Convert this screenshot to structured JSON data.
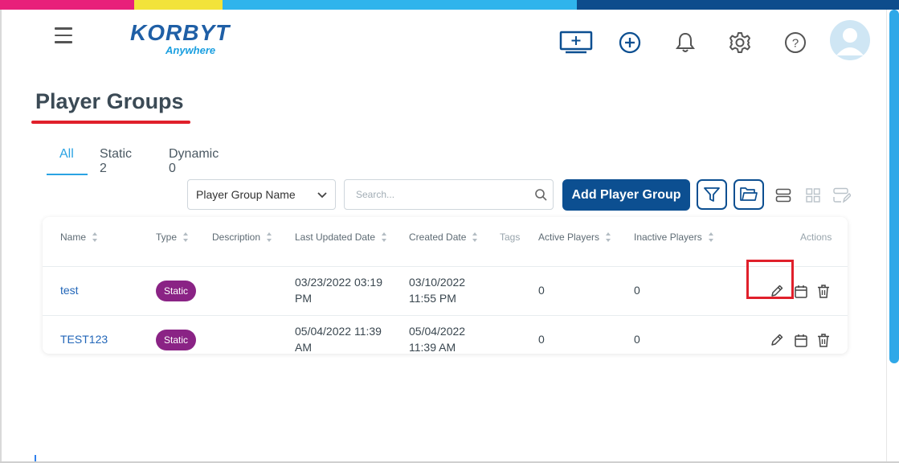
{
  "colors": {
    "topbar": [
      "#e8207a",
      "#f2e33a",
      "#2fb4ec",
      "#0d4c8c"
    ],
    "primary": "#0c4f91",
    "accent_tab": "#2aa3e3",
    "badge": "#8a2385",
    "highlight": "#e0202b"
  },
  "header": {
    "logo_main": "KORBYT",
    "logo_sub": "Anywhere",
    "icons": [
      "menu-icon",
      "add-screen-icon",
      "add-circle-icon",
      "bell-icon",
      "gear-icon",
      "help-icon",
      "user-avatar-icon"
    ]
  },
  "page": {
    "title": "Player Groups"
  },
  "tabs": [
    {
      "label": "All",
      "active": true
    },
    {
      "label": "Static 2",
      "active": false
    },
    {
      "label": "Dynamic 0",
      "active": false
    }
  ],
  "toolbar": {
    "filter_select": "Player Group Name",
    "search_placeholder": "Search...",
    "add_button": "Add Player Group",
    "icons": [
      "filter-icon",
      "folder-icon",
      "list-view-icon",
      "grid-view-icon",
      "edit-view-icon"
    ]
  },
  "table": {
    "headers": {
      "name": "Name",
      "type": "Type",
      "description": "Description",
      "updated": "Last Updated Date",
      "created": "Created Date",
      "tags": "Tags",
      "active": "Active Players",
      "inactive": "Inactive Players",
      "actions": "Actions"
    },
    "rows": [
      {
        "name": "test",
        "type": "Static",
        "description": "",
        "updated_1": "03/23/2022 03:19",
        "updated_2": "PM",
        "created_1": "03/10/2022",
        "created_2": "11:55 PM",
        "active": "0",
        "inactive": "0"
      },
      {
        "name": "TEST123",
        "type": "Static",
        "description": "",
        "updated_1": "05/04/2022 11:39",
        "updated_2": "AM",
        "created_1": "05/04/2022",
        "created_2": "11:39 AM",
        "active": "0",
        "inactive": "0"
      }
    ],
    "row_actions": [
      "edit-icon",
      "calendar-icon",
      "trash-icon"
    ]
  }
}
